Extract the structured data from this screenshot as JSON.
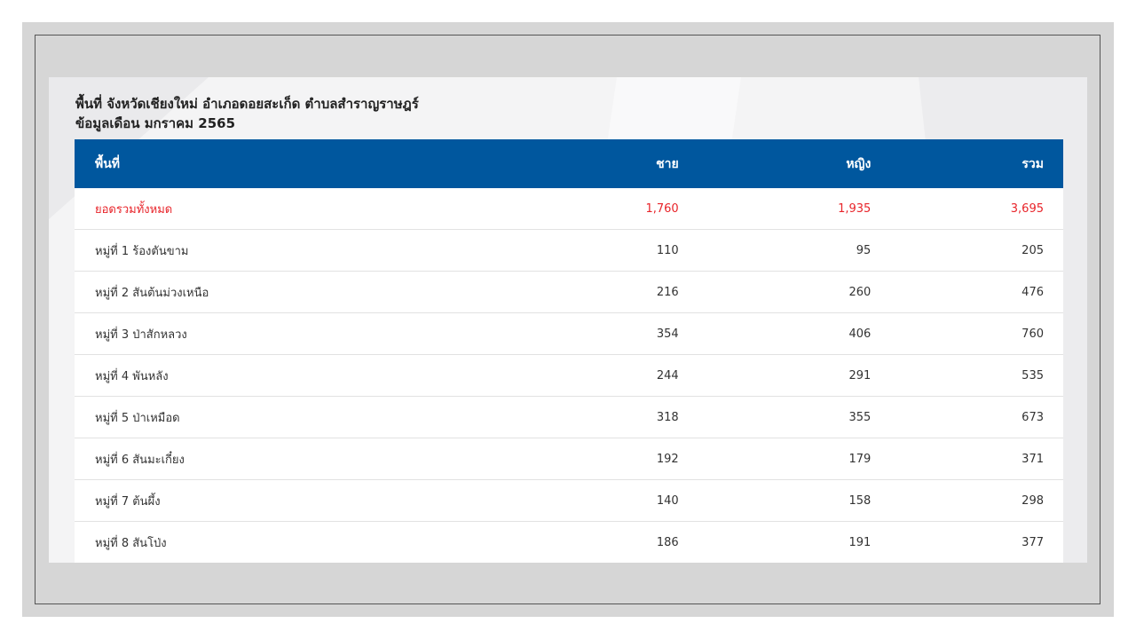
{
  "heading": {
    "line1": "พื้นที่ จังหวัดเชียงใหม่ อำเภอดอยสะเก็ด ตำบลสำราญราษฎร์",
    "line2": "ข้อมูลเดือน มกราคม 2565"
  },
  "table": {
    "headers": {
      "area": "พื้นที่",
      "male": "ชาย",
      "female": "หญิง",
      "total": "รวม"
    },
    "total_row": {
      "area": "ยอดรวมทั้งหมด",
      "male": "1,760",
      "female": "1,935",
      "total": "3,695"
    },
    "rows": [
      {
        "area": "หมู่ที่ 1 ร้องตันขาม",
        "male": "110",
        "female": "95",
        "total": "205"
      },
      {
        "area": "หมู่ที่ 2 สันต้นม่วงเหนือ",
        "male": "216",
        "female": "260",
        "total": "476"
      },
      {
        "area": "หมู่ที่ 3 ป่าสักหลวง",
        "male": "354",
        "female": "406",
        "total": "760"
      },
      {
        "area": "หมู่ที่ 4 พันหลัง",
        "male": "244",
        "female": "291",
        "total": "535"
      },
      {
        "area": "หมู่ที่ 5 ป่าเหมือด",
        "male": "318",
        "female": "355",
        "total": "673"
      },
      {
        "area": "หมู่ที่ 6 สันมะเกี๋ยง",
        "male": "192",
        "female": "179",
        "total": "371"
      },
      {
        "area": "หมู่ที่ 7 ต้นผึ้ง",
        "male": "140",
        "female": "158",
        "total": "298"
      },
      {
        "area": "หมู่ที่ 8 สันโป่ง",
        "male": "186",
        "female": "191",
        "total": "377"
      }
    ]
  },
  "colors": {
    "header_bg": "#00579e",
    "total_text": "#e8242a",
    "page_bg": "#d6d6d6"
  }
}
